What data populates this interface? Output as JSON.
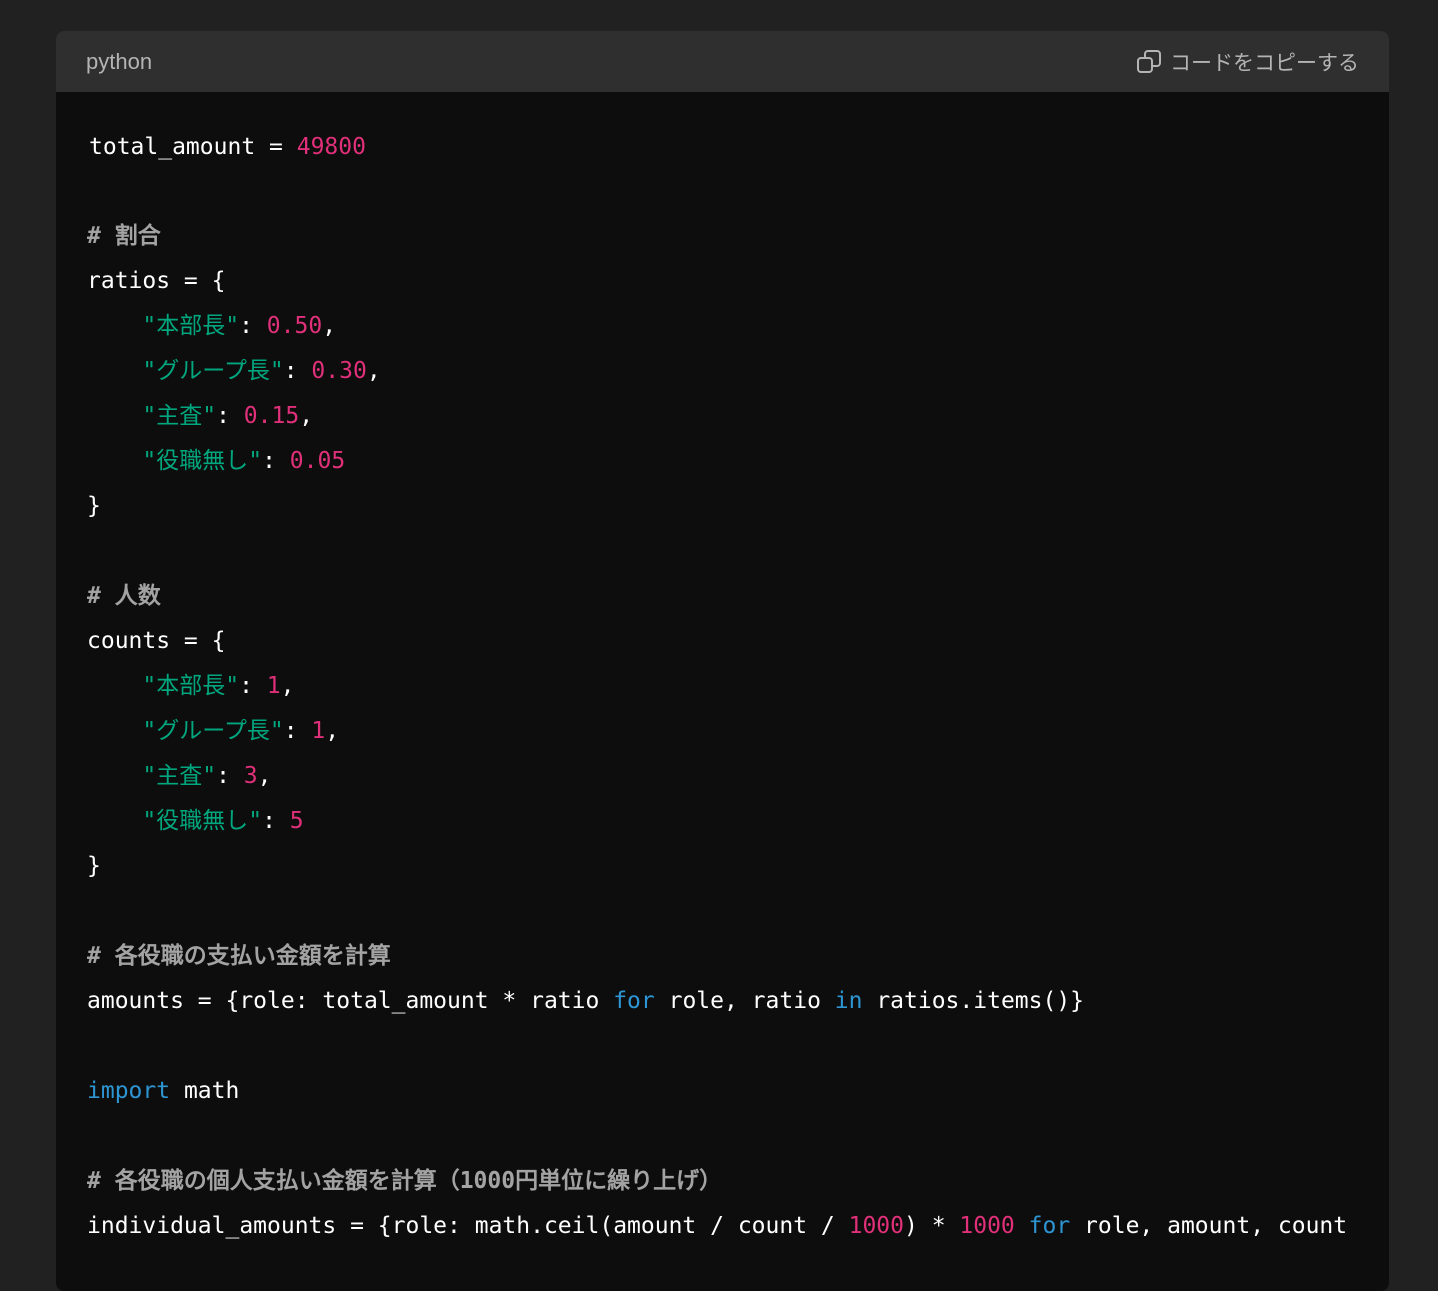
{
  "header": {
    "language": "python",
    "copy_label": "コードをコピーする"
  },
  "code_lines": [
    [
      {
        "t": "total_amount = ",
        "c": "plain"
      },
      {
        "t": "49800",
        "c": "num"
      }
    ],
    [
      {
        "t": "# 割合",
        "c": "cm"
      }
    ],
    [
      {
        "t": "ratios = {",
        "c": "plain"
      }
    ],
    [
      {
        "t": "    ",
        "c": "plain"
      },
      {
        "t": "\"本部長\"",
        "c": "str"
      },
      {
        "t": ": ",
        "c": "plain"
      },
      {
        "t": "0.50",
        "c": "num"
      },
      {
        "t": ",",
        "c": "plain"
      }
    ],
    [
      {
        "t": "    ",
        "c": "plain"
      },
      {
        "t": "\"グループ長\"",
        "c": "str"
      },
      {
        "t": ": ",
        "c": "plain"
      },
      {
        "t": "0.30",
        "c": "num"
      },
      {
        "t": ",",
        "c": "plain"
      }
    ],
    [
      {
        "t": "    ",
        "c": "plain"
      },
      {
        "t": "\"主査\"",
        "c": "str"
      },
      {
        "t": ": ",
        "c": "plain"
      },
      {
        "t": "0.15",
        "c": "num"
      },
      {
        "t": ",",
        "c": "plain"
      }
    ],
    [
      {
        "t": "    ",
        "c": "plain"
      },
      {
        "t": "\"役職無し\"",
        "c": "str"
      },
      {
        "t": ": ",
        "c": "plain"
      },
      {
        "t": "0.05",
        "c": "num"
      }
    ],
    [
      {
        "t": "}",
        "c": "plain"
      }
    ],
    [
      {
        "t": "# 人数",
        "c": "cm"
      }
    ],
    [
      {
        "t": "counts = {",
        "c": "plain"
      }
    ],
    [
      {
        "t": "    ",
        "c": "plain"
      },
      {
        "t": "\"本部長\"",
        "c": "str"
      },
      {
        "t": ": ",
        "c": "plain"
      },
      {
        "t": "1",
        "c": "num"
      },
      {
        "t": ",",
        "c": "plain"
      }
    ],
    [
      {
        "t": "    ",
        "c": "plain"
      },
      {
        "t": "\"グループ長\"",
        "c": "str"
      },
      {
        "t": ": ",
        "c": "plain"
      },
      {
        "t": "1",
        "c": "num"
      },
      {
        "t": ",",
        "c": "plain"
      }
    ],
    [
      {
        "t": "    ",
        "c": "plain"
      },
      {
        "t": "\"主査\"",
        "c": "str"
      },
      {
        "t": ": ",
        "c": "plain"
      },
      {
        "t": "3",
        "c": "num"
      },
      {
        "t": ",",
        "c": "plain"
      }
    ],
    [
      {
        "t": "    ",
        "c": "plain"
      },
      {
        "t": "\"役職無し\"",
        "c": "str"
      },
      {
        "t": ": ",
        "c": "plain"
      },
      {
        "t": "5",
        "c": "num"
      }
    ],
    [
      {
        "t": "}",
        "c": "plain"
      }
    ],
    [
      {
        "t": "# 各役職の支払い金額を計算",
        "c": "cm"
      }
    ],
    [
      {
        "t": "amounts = {role: total_amount * ratio ",
        "c": "plain"
      },
      {
        "t": "for",
        "c": "kw"
      },
      {
        "t": " role, ratio ",
        "c": "plain"
      },
      {
        "t": "in",
        "c": "kw"
      },
      {
        "t": " ratios.items()}",
        "c": "plain"
      }
    ],
    [
      {
        "t": "import",
        "c": "kw"
      },
      {
        "t": " math",
        "c": "plain"
      }
    ],
    [
      {
        "t": "# 各役職の個人支払い金額を計算（1000円単位に繰り上げ）",
        "c": "cm"
      }
    ],
    [
      {
        "t": "individual_amounts = {role: math.ceil(amount / count / ",
        "c": "plain"
      },
      {
        "t": "1000",
        "c": "num"
      },
      {
        "t": ") * ",
        "c": "plain"
      },
      {
        "t": "1000",
        "c": "num"
      },
      {
        "t": " ",
        "c": "plain"
      },
      {
        "t": "for",
        "c": "kw"
      },
      {
        "t": " role, amount, count",
        "c": "plain"
      }
    ]
  ]
}
